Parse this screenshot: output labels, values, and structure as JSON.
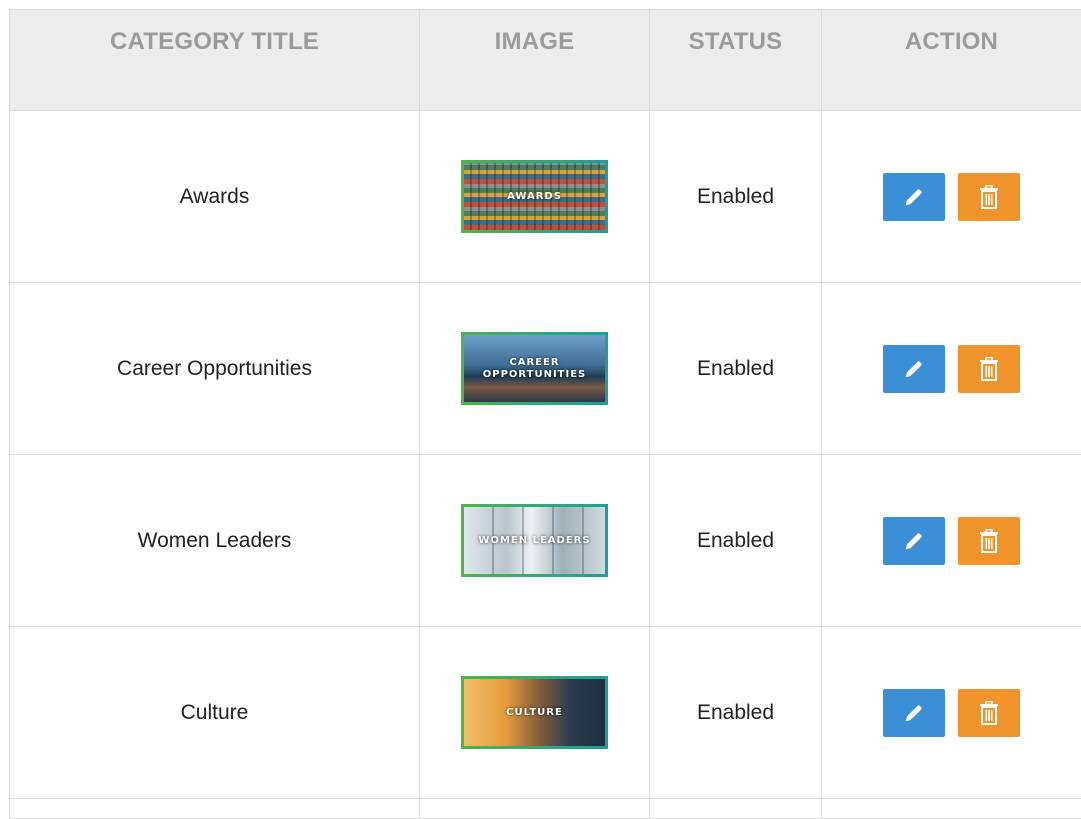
{
  "table": {
    "headers": [
      "CATEGORY TITLE",
      "IMAGE",
      "STATUS",
      "ACTION"
    ],
    "rows": [
      {
        "title": "Awards",
        "image_caption": "AWARDS",
        "status": "Enabled"
      },
      {
        "title": "Career Opportunities",
        "image_caption": "CAREER\nOPPORTUNITIES",
        "status": "Enabled"
      },
      {
        "title": "Women Leaders",
        "image_caption": "WOMEN LEADERS",
        "status": "Enabled"
      },
      {
        "title": "Culture",
        "image_caption": "CULTURE",
        "status": "Enabled"
      }
    ]
  },
  "icons": {
    "edit": "pencil-icon",
    "delete": "trash-icon"
  },
  "colors": {
    "header_bg": "#ececec",
    "header_text": "#9b9b9b",
    "edit_button": "#3b8fd6",
    "delete_button": "#f0932b",
    "thumb_border_start": "#49b649",
    "thumb_border_end": "#17a19a"
  }
}
